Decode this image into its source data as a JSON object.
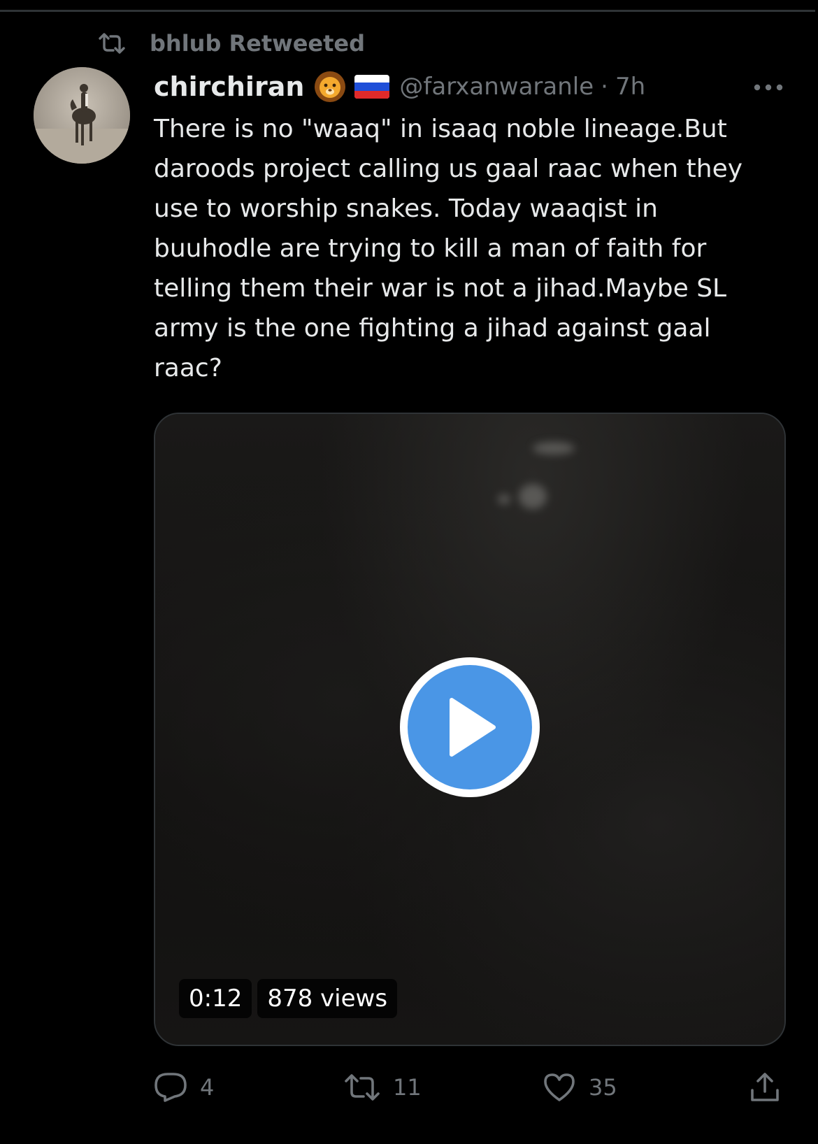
{
  "retweet_context": {
    "label": "bhlub Retweeted",
    "icon": "retweet-icon"
  },
  "tweet": {
    "author": {
      "display_name": "chirchiran",
      "name_emoji": "lion-face-emoji",
      "flag": "russia-flag-emoji",
      "handle": "@farxanwaranle",
      "separator": "·",
      "timestamp": "7h",
      "avatar": "horse-rider-photo"
    },
    "more_icon": "more-dots-icon",
    "text": "There is no \"waaq\" in isaaq noble lineage.But daroods project calling us gaal raac when they use to worship snakes. Today waaqist in buuhodle are trying to kill a man of faith for telling them their war is not a jihad.Maybe SL army is the one fighting a jihad against gaal raac?",
    "media": {
      "type": "video",
      "play_icon": "play-icon",
      "duration": "0:12",
      "views": "878 views",
      "play_color": "#4a96e6"
    },
    "actions": {
      "replies": "4",
      "retweets": "11",
      "likes": "35",
      "reply_icon": "reply-icon",
      "retweet_icon": "retweet-icon",
      "like_icon": "heart-icon",
      "share_icon": "share-icon"
    }
  },
  "colors": {
    "background": "#000000",
    "primary_text": "#e7e9ea",
    "secondary_text": "#71767b",
    "divider": "#2f3336"
  }
}
